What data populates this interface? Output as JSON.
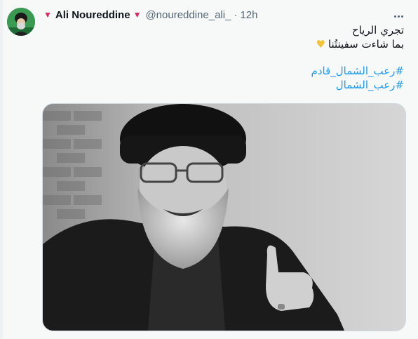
{
  "tweet": {
    "author": {
      "name_prefix_icon": "red-heart-icon",
      "display_name": "Ali Noureddine",
      "name_suffix_icon": "red-heart-icon",
      "handle": "@noureddine_ali_",
      "separator": "·",
      "time": "12h"
    },
    "more_icon": "more-options-icon",
    "text": {
      "line1": "تجري الرياح",
      "line2": "بما شاءت سفينتُنا",
      "line2_emoji": "💛",
      "hashtag1": "#رعب_الشمال_قادم",
      "hashtag2": "#رعب_الشمال"
    },
    "media": {
      "kind": "photo",
      "tone": "black-and-white"
    }
  },
  "colors": {
    "link": "#1d9bf0",
    "muted": "#536471",
    "heart": "#e0245e",
    "background": "#f7f9f9"
  }
}
